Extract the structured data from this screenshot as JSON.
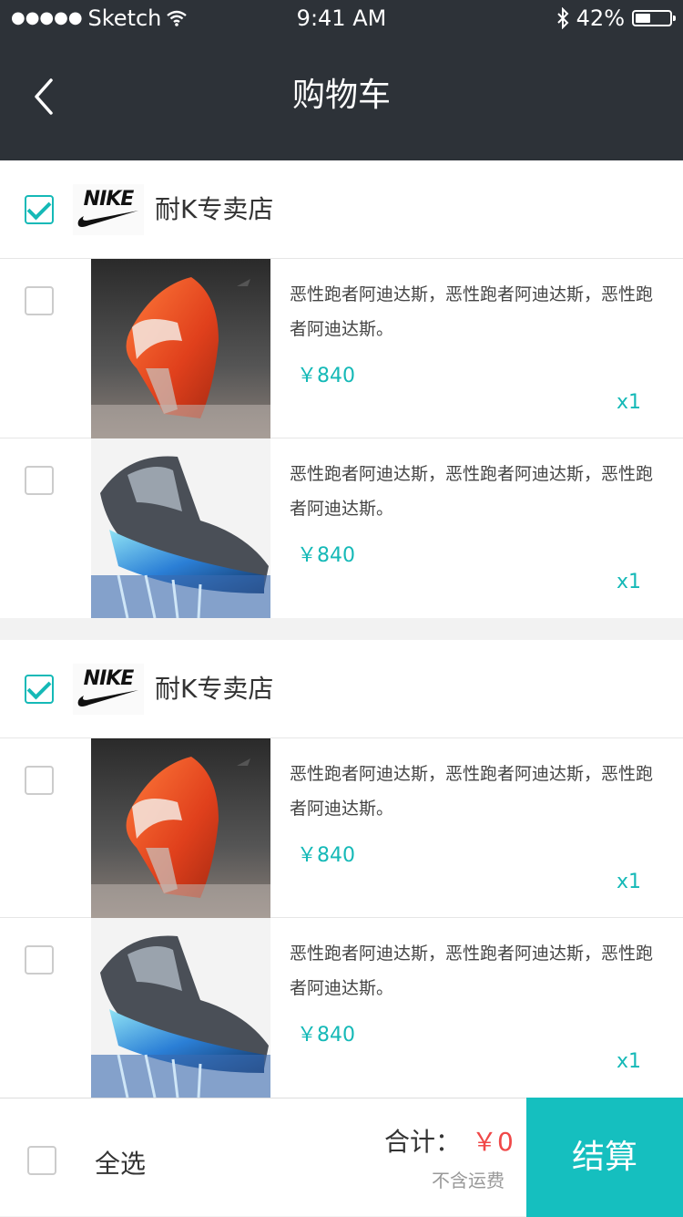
{
  "status_bar": {
    "carrier": "Sketch",
    "time": "9:41 AM",
    "battery": "42%",
    "battery_level": 0.42
  },
  "nav": {
    "title": "购物车"
  },
  "groups": [
    {
      "shop_name": "耐K专卖店",
      "logo_text": "NIKE",
      "checked": true,
      "items": [
        {
          "desc": "恶性跑者阿迪达斯，恶性跑者阿迪达斯，恶性跑者阿迪达斯。",
          "price": "￥840",
          "qty": "x1",
          "image": "orange-sneaker"
        },
        {
          "desc": "恶性跑者阿迪达斯，恶性跑者阿迪达斯，恶性跑者阿迪达斯。",
          "price": "￥840",
          "qty": "x1",
          "image": "blue-sneaker"
        }
      ]
    },
    {
      "shop_name": "耐K专卖店",
      "logo_text": "NIKE",
      "checked": true,
      "items": [
        {
          "desc": "恶性跑者阿迪达斯，恶性跑者阿迪达斯，恶性跑者阿迪达斯。",
          "price": "￥840",
          "qty": "x1",
          "image": "orange-sneaker"
        },
        {
          "desc": "恶性跑者阿迪达斯，恶性跑者阿迪达斯，恶性跑者阿迪达斯。",
          "price": "￥840",
          "qty": "x1",
          "image": "blue-sneaker"
        }
      ]
    }
  ],
  "footer": {
    "select_all": "全选",
    "total_label": "合计：",
    "total_value": "￥0",
    "shipping_note": "不含运费",
    "checkout": "结算"
  },
  "colors": {
    "accent": "#15b9b7",
    "price_red": "#f04848",
    "header": "#2d3238"
  }
}
